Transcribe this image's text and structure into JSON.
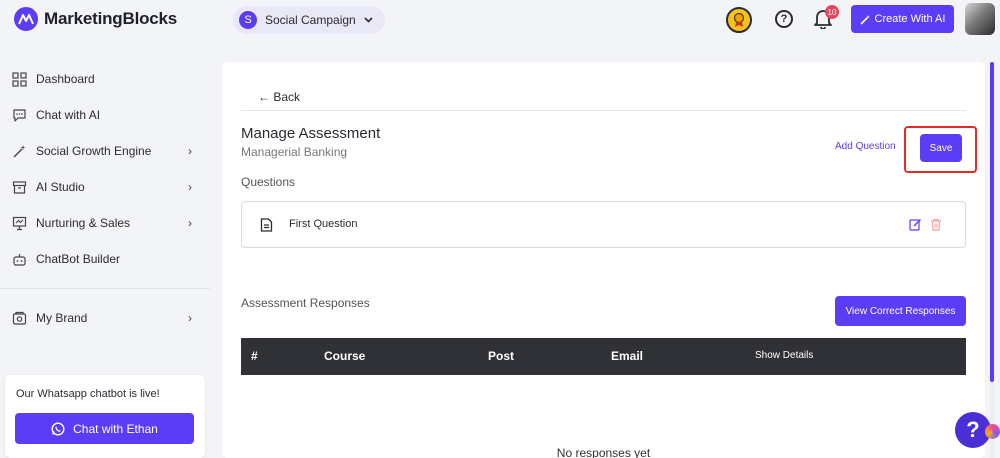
{
  "brand": {
    "name": "MarketingBlocks",
    "accent": "#5b3df5"
  },
  "header": {
    "workspace_initial": "S",
    "workspace_name": "Social Campaign",
    "notification_count": "10",
    "create_label": "Create With AI"
  },
  "sidebar": {
    "items": [
      {
        "label": "Dashboard",
        "icon": "grid-icon"
      },
      {
        "label": "Chat with AI",
        "icon": "chat-icon"
      },
      {
        "label": "Social Growth Engine",
        "icon": "magic-wand-icon",
        "chevron": "›"
      },
      {
        "label": "AI Studio",
        "icon": "archive-icon",
        "chevron": "›"
      },
      {
        "label": "Nurturing & Sales",
        "icon": "presentation-icon",
        "chevron": "›"
      },
      {
        "label": "ChatBot Builder",
        "icon": "bot-icon"
      },
      {
        "label": "My Brand",
        "icon": "brand-box-icon",
        "chevron": "›"
      }
    ],
    "whatsapp_text": "Our Whatsapp chatbot is live!",
    "whatsapp_button": "Chat with Ethan"
  },
  "main": {
    "back_label": "← Back",
    "title": "Manage Assessment",
    "subtitle": "Managerial Banking",
    "add_question": "Add Question",
    "save": "Save",
    "questions_label": "Questions",
    "questions": [
      {
        "text": "First Question"
      }
    ],
    "responses_label": "Assessment Responses",
    "view_correct": "View Correct Responses",
    "table_headers": [
      "#",
      "Course",
      "Post",
      "Email",
      "Show Details"
    ],
    "empty_text": "No responses yet"
  },
  "help": {
    "label": "?"
  }
}
